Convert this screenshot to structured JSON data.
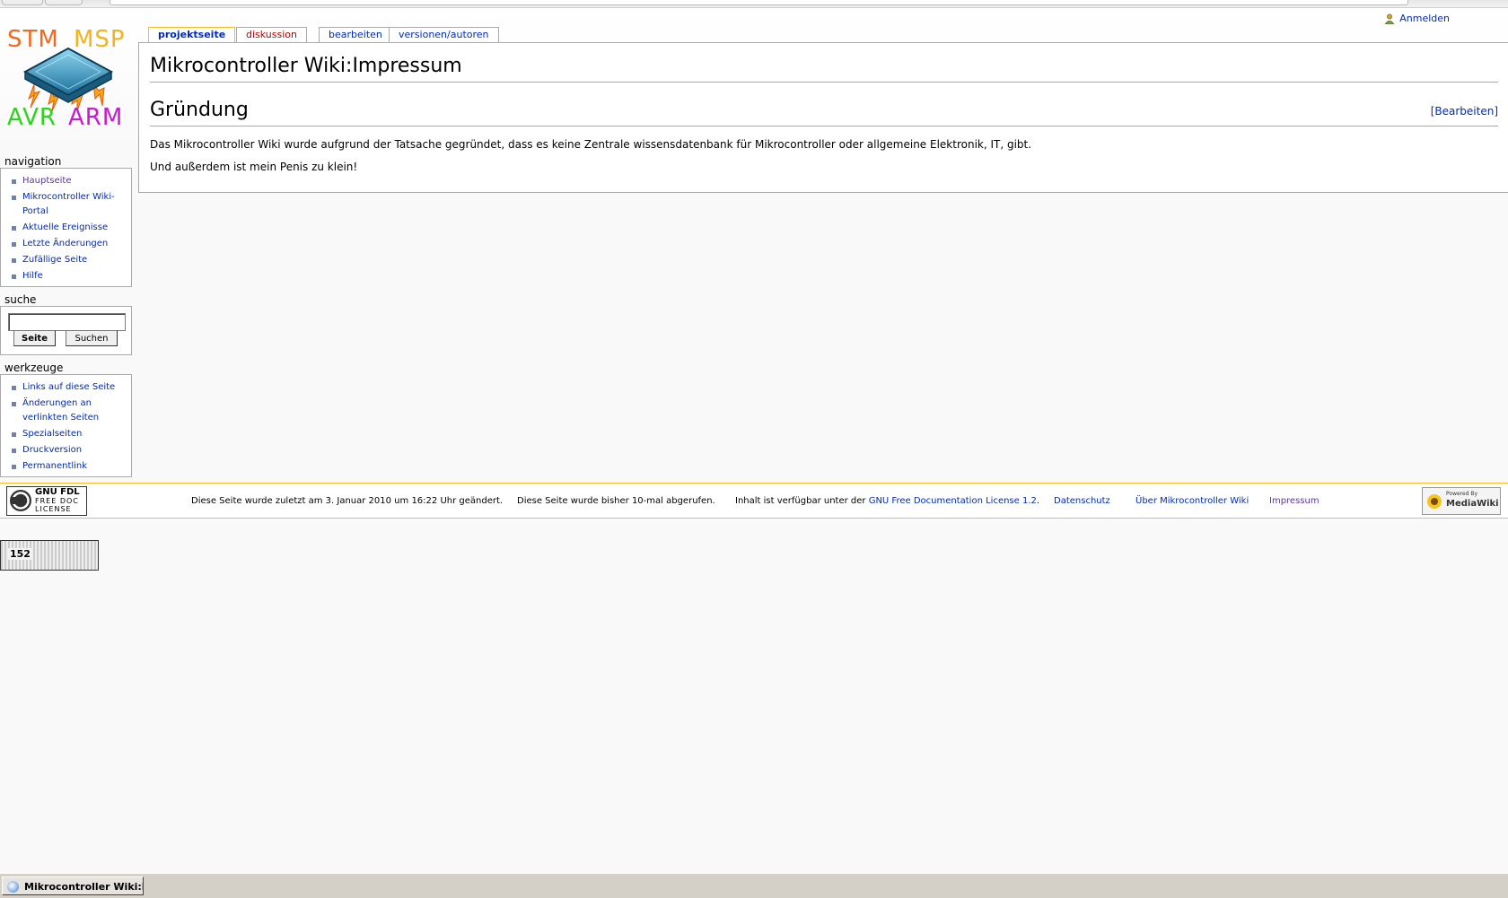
{
  "logo": {
    "words": [
      "STM",
      "MSP",
      "AVR",
      "ARM"
    ],
    "colors": {
      "STM": "#f26a21",
      "MSP": "#f6b21b",
      "AVR": "#2bd51b",
      "ARM": "#c71bcf"
    }
  },
  "personal_tools": {
    "login_label": "Anmelden"
  },
  "tabs": [
    {
      "label": "projektseite",
      "selected": true
    },
    {
      "label": "diskussion",
      "selected": false,
      "new": true
    },
    {
      "label": "bearbeiten",
      "selected": false
    },
    {
      "label": "versionen/autoren",
      "selected": false
    }
  ],
  "content": {
    "title": "Mikrocontroller Wiki:Impressum",
    "section_title": "Gründung",
    "section_edit": "[Bearbeiten]",
    "paragraphs": [
      "Das Mikrocontroller Wiki wurde aufgrund der Tatsache gegründet, dass es keine Zentrale wissensdatenbank für Mikrocontroller oder allgemeine Elektronik, IT, gibt.",
      "Und außerdem ist mein Penis zu klein!"
    ]
  },
  "sidebar": {
    "navigation": {
      "heading": "navigation",
      "items": [
        "Hauptseite",
        "Mikrocontroller Wiki-Portal",
        "Aktuelle Ereignisse",
        "Letzte Änderungen",
        "Zufällige Seite",
        "Hilfe"
      ]
    },
    "search": {
      "heading": "suche",
      "input_value": "",
      "go_button": "Seite",
      "search_button": "Suchen"
    },
    "tools": {
      "heading": "werkzeuge",
      "items": [
        "Links auf diese Seite",
        "Änderungen an verlinkten Seiten",
        "Spezialseiten",
        "Druckversion",
        "Permanentlink"
      ]
    }
  },
  "footer": {
    "gfdl_badge": [
      "GNU FDL",
      "FREE DOC",
      "LICENSE"
    ],
    "last_modified": "Diese Seite wurde zuletzt am 3. Januar 2010 um 16:22 Uhr geändert.",
    "view_count": "Diese Seite wurde bisher 10-mal abgerufen.",
    "license_prefix": "Inhalt ist verfügbar unter der ",
    "license_link": "GNU Free Documentation License 1.2",
    "license_suffix": ".",
    "privacy": "Datenschutz",
    "about": "Über Mikrocontroller Wiki",
    "impressum": "Impressum",
    "mediawiki_badge": [
      "Powered By",
      "MediaWiki"
    ]
  },
  "counter": {
    "value": "152"
  },
  "taskbar": {
    "window_label": "Mikrocontroller Wiki:I..."
  }
}
